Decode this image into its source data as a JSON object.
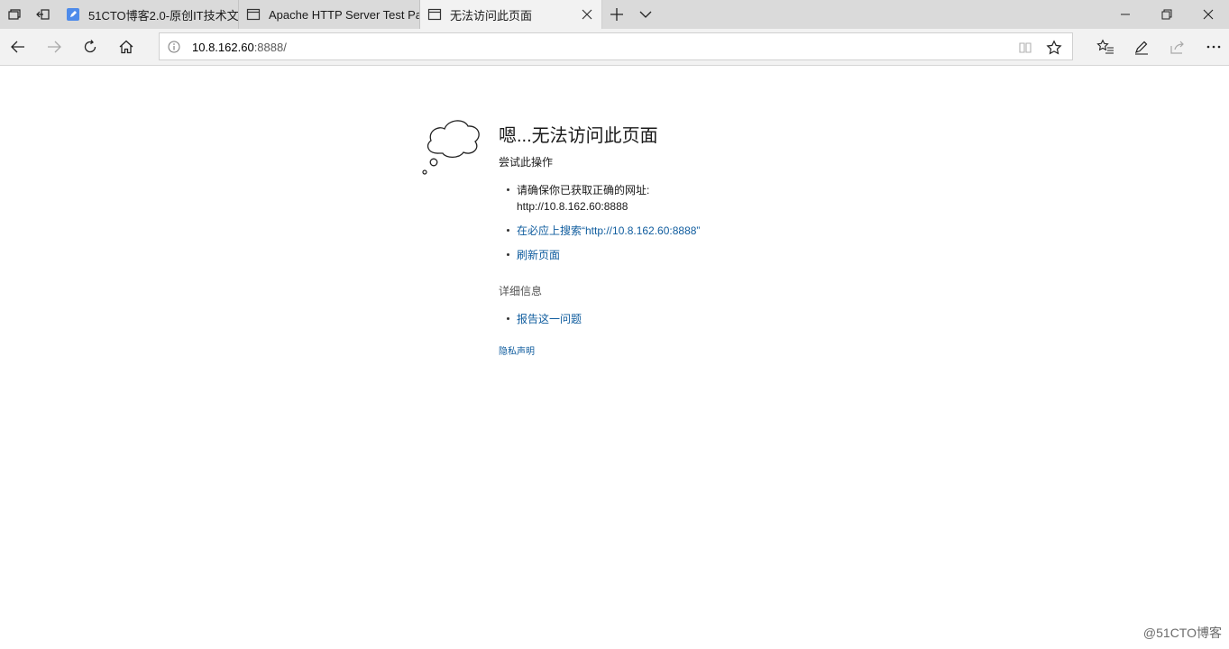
{
  "tabs": [
    {
      "title": "51CTO博客2.0-原创IT技术文",
      "favicon": "edit-pencil-icon",
      "active": false
    },
    {
      "title": "Apache HTTP Server Test Pa",
      "favicon": "page-icon",
      "active": false
    },
    {
      "title": "无法访问此页面",
      "favicon": "page-icon",
      "active": true
    }
  ],
  "address": {
    "host": "10.8.162.60",
    "rest": ":8888/"
  },
  "error": {
    "title": "嗯...无法访问此页面",
    "subtitle": "尝试此操作",
    "suggestions": [
      {
        "line1": "请确保你已获取正确的网址:",
        "line2": "http://10.8.162.60:8888"
      },
      {
        "text": "在必应上搜索“http://10.8.162.60:8888”"
      },
      {
        "text": "刷新页面"
      }
    ],
    "details_heading": "详细信息",
    "report_link": "报告这一问题",
    "privacy_link": "隐私声明"
  },
  "watermark": "@51CTO博客",
  "colors": {
    "link": "#0f5c9e",
    "tabstrip": "#dadada",
    "toolbar": "#f2f2f2"
  }
}
